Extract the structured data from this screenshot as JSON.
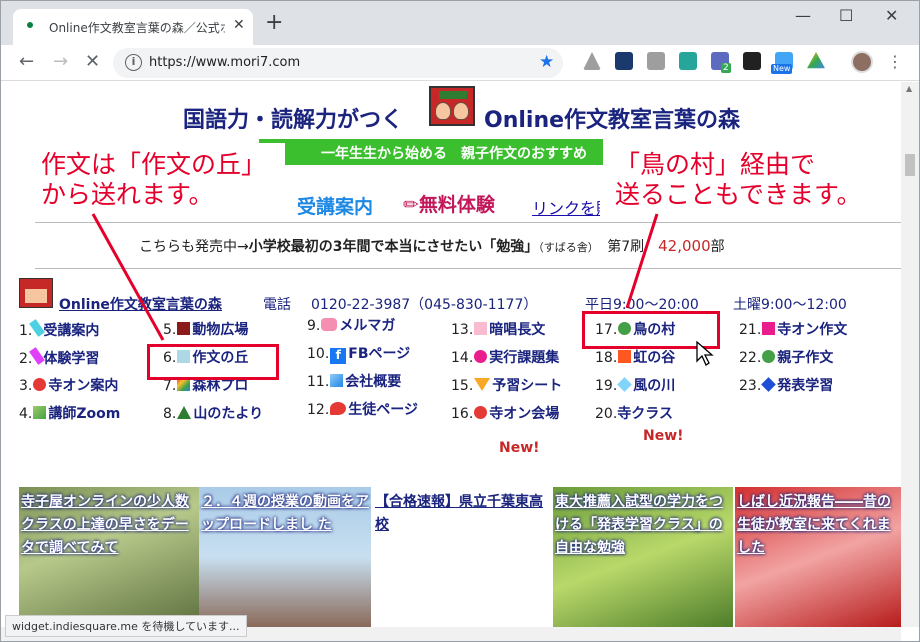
{
  "browser": {
    "tab_title": "Online作文教室言葉の森／公式ホ",
    "tab_close": "✕",
    "new_tab": "+",
    "url": "https://www.mori7.com",
    "url_placeholder": "",
    "window_minimize": "—",
    "window_maximize": "☐",
    "window_close": "✕",
    "ext_badge_count": "2",
    "ext_new_label": "New",
    "status_text": "widget.indiesquare.me を待機しています..."
  },
  "header": {
    "title_left": "国語力・読解力がつく",
    "title_right": "Online作文教室言葉の森",
    "subtitle": "一年生生から始める　親子作文のおすすめ"
  },
  "nav": {
    "juko": "受講案内",
    "muryo": "無料体験",
    "link": "リンクを貼"
  },
  "promo": {
    "lead": "こちらも発売中→",
    "book": "小学校最初の3年間で本当にさせたい「勉強」",
    "publisher": "（すばる舎）",
    "edition": "第7刷",
    "copies": "42,000",
    "copies_unit": "部"
  },
  "info": {
    "site_name": "Online作文教室言葉の森",
    "phone_label": "電話",
    "phone": "0120-22-3987（045-830-1177）",
    "weekday_hours": "平日9:00～20:00",
    "saturday_hours": "土曜9:00～12:00"
  },
  "menu": [
    {
      "num": "1.",
      "label": "受講案内",
      "icon": "pencil-icon",
      "color": "#4dd0e1"
    },
    {
      "num": "2.",
      "label": "体験学習",
      "icon": "pencil-icon",
      "color": "#e040fb"
    },
    {
      "num": "3.",
      "label": "寺オン案内",
      "icon": "red-circle-icon",
      "color": "#e53935"
    },
    {
      "num": "4.",
      "label": "講師Zoom",
      "icon": "green-gradient-icon",
      "color": "#43a047"
    },
    {
      "num": "5.",
      "label": "動物広場",
      "icon": "square-icon",
      "color": "#8b1a1a"
    },
    {
      "num": "6.",
      "label": "作文の丘",
      "icon": "square-icon",
      "color": "#add8e6"
    },
    {
      "num": "7.",
      "label": "森林プロ",
      "icon": "rainbow-icon",
      "color": "#ff9800"
    },
    {
      "num": "8.",
      "label": "山のたより",
      "icon": "triangle-icon",
      "color": "#2e7d32"
    },
    {
      "num": "9.",
      "label": "メルマガ",
      "icon": "character-icon",
      "color": "#f48fb1"
    },
    {
      "num": "10.",
      "label": "FBページ",
      "icon": "facebook-icon",
      "color": "#1877f2"
    },
    {
      "num": "11.",
      "label": "会社概要",
      "icon": "blue-gradient-icon",
      "color": "#1e88e5"
    },
    {
      "num": "12.",
      "label": "生徒ページ",
      "icon": "bird-icon",
      "color": "#e53935"
    },
    {
      "num": "13.",
      "label": "暗唱長文",
      "icon": "square-icon",
      "color": "#f8bbd0"
    },
    {
      "num": "14.",
      "label": "実行課題集",
      "icon": "circle-icon",
      "color": "#e91e8c"
    },
    {
      "num": "15.",
      "label": "予習シート",
      "icon": "triangle-down-icon",
      "color": "#f9a825"
    },
    {
      "num": "16.",
      "label": "寺オン会場",
      "icon": "circle-icon",
      "color": "#e53935"
    },
    {
      "num": "17.",
      "label": "鳥の村",
      "icon": "circle-icon",
      "color": "#43a047"
    },
    {
      "num": "18.",
      "label": "虹の谷",
      "icon": "square-icon",
      "color": "#ff5722"
    },
    {
      "num": "19.",
      "label": "風の川",
      "icon": "diamond-icon",
      "color": "#81d4fa"
    },
    {
      "num": "20.",
      "label": "寺クラス",
      "icon": "star-icon",
      "color": "#f9a825"
    },
    {
      "num": "21.",
      "label": "寺オン作文",
      "icon": "square-icon",
      "color": "#e91e8c"
    },
    {
      "num": "22.",
      "label": "親子作文",
      "icon": "circle-icon",
      "color": "#43a047"
    },
    {
      "num": "23.",
      "label": "発表学習",
      "icon": "diamond-icon",
      "color": "#1e4fd6"
    }
  ],
  "badges": {
    "new1": "New!",
    "new2": "New!"
  },
  "annotations": {
    "left_line1": "作文は「作文の丘」",
    "left_line2": "から送れます。",
    "right_line1": "「鳥の村」経由で",
    "right_line2": "送ることもできます。",
    "color": "#e4002b"
  },
  "news": [
    {
      "text": "寺子屋オンラインの少人数クラスの上達の早さをデータで調べてみて"
    },
    {
      "text": "２．４週の授業の動画をアップロードしまし た"
    },
    {
      "text": "【合格速報】県立千葉東高校"
    },
    {
      "text": "東大推薦入試型の学力をつける「発表学習クラス」の自由な勉強"
    },
    {
      "text": "しばし近況報告――昔の生徒が教室に来てくれました"
    }
  ]
}
